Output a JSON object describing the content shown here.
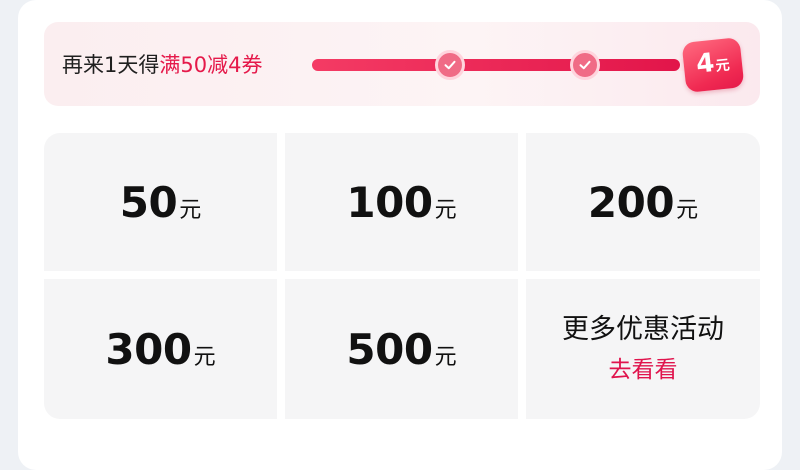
{
  "colors": {
    "accent": "#e5194a",
    "progress_track": "#fde7eb",
    "cell_bg": "#f5f5f6",
    "text": "#111111"
  },
  "promo": {
    "prefix": "再来1天得",
    "highlight": "满50减4券",
    "progress_fraction": 0.92,
    "checkpoints": [
      "check-icon",
      "check-icon"
    ],
    "badge_value": "4",
    "badge_unit": "元"
  },
  "options": [
    {
      "value": "50",
      "unit": "元"
    },
    {
      "value": "100",
      "unit": "元"
    },
    {
      "value": "200",
      "unit": "元"
    },
    {
      "value": "300",
      "unit": "元"
    },
    {
      "value": "500",
      "unit": "元"
    }
  ],
  "more": {
    "title": "更多优惠活动",
    "link": "去看看"
  }
}
